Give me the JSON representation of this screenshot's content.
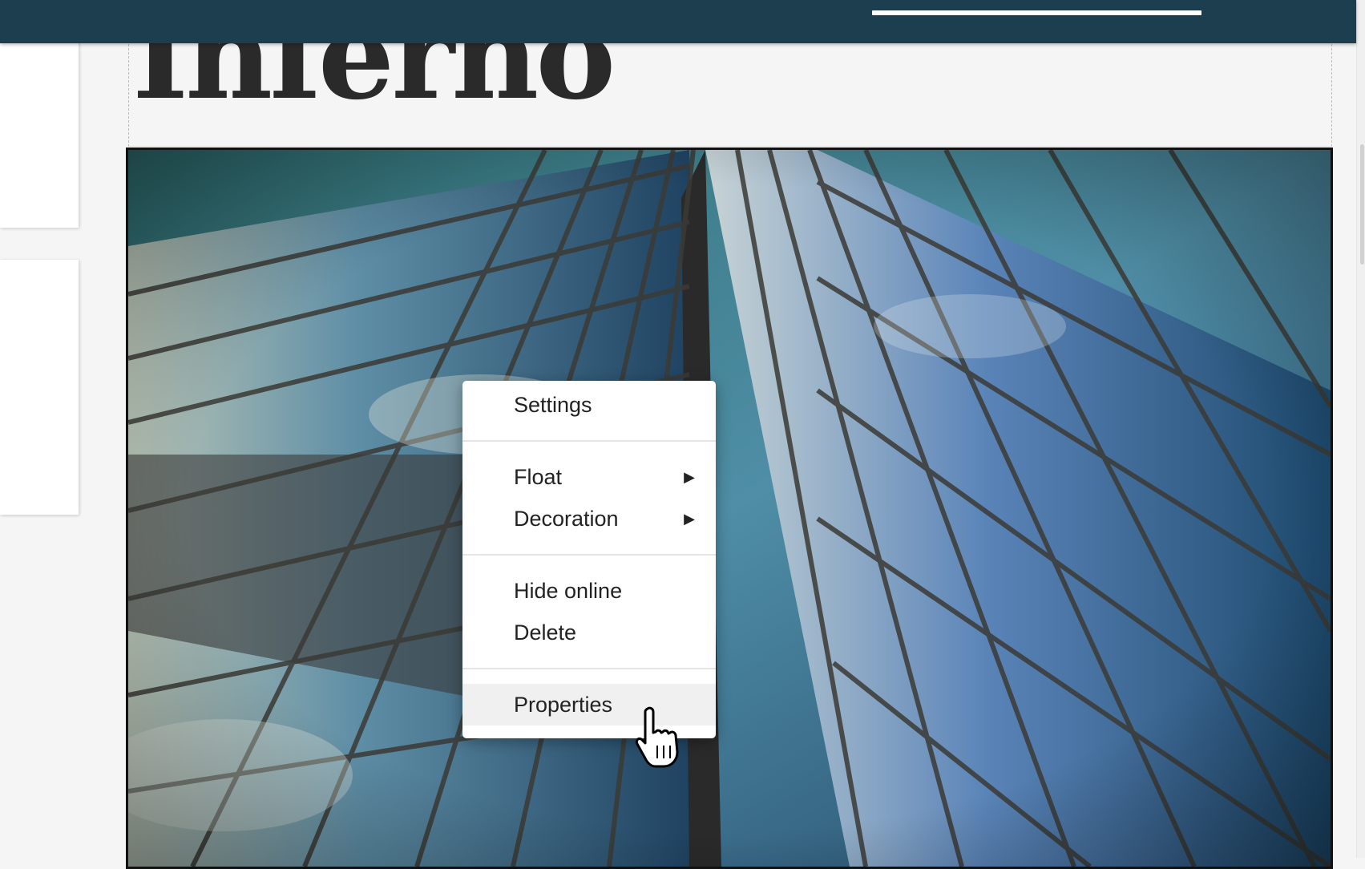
{
  "page": {
    "heading": "Inferno"
  },
  "context_menu": {
    "groups": [
      {
        "items": [
          {
            "label": "Settings",
            "has_submenu": false
          }
        ]
      },
      {
        "items": [
          {
            "label": "Float",
            "has_submenu": true
          },
          {
            "label": "Decoration",
            "has_submenu": true
          }
        ]
      },
      {
        "items": [
          {
            "label": "Hide online",
            "has_submenu": false
          },
          {
            "label": "Delete",
            "has_submenu": false
          }
        ]
      },
      {
        "items": [
          {
            "label": "Properties",
            "has_submenu": false,
            "hovered": true
          }
        ]
      }
    ],
    "submenu_arrow": "▶"
  },
  "colors": {
    "topbar": "#1c3e4f",
    "menu_hover": "#f0f0f0"
  },
  "icons": {
    "cursor": "pointer-hand-cursor-icon",
    "submenu": "submenu-arrow-icon"
  }
}
